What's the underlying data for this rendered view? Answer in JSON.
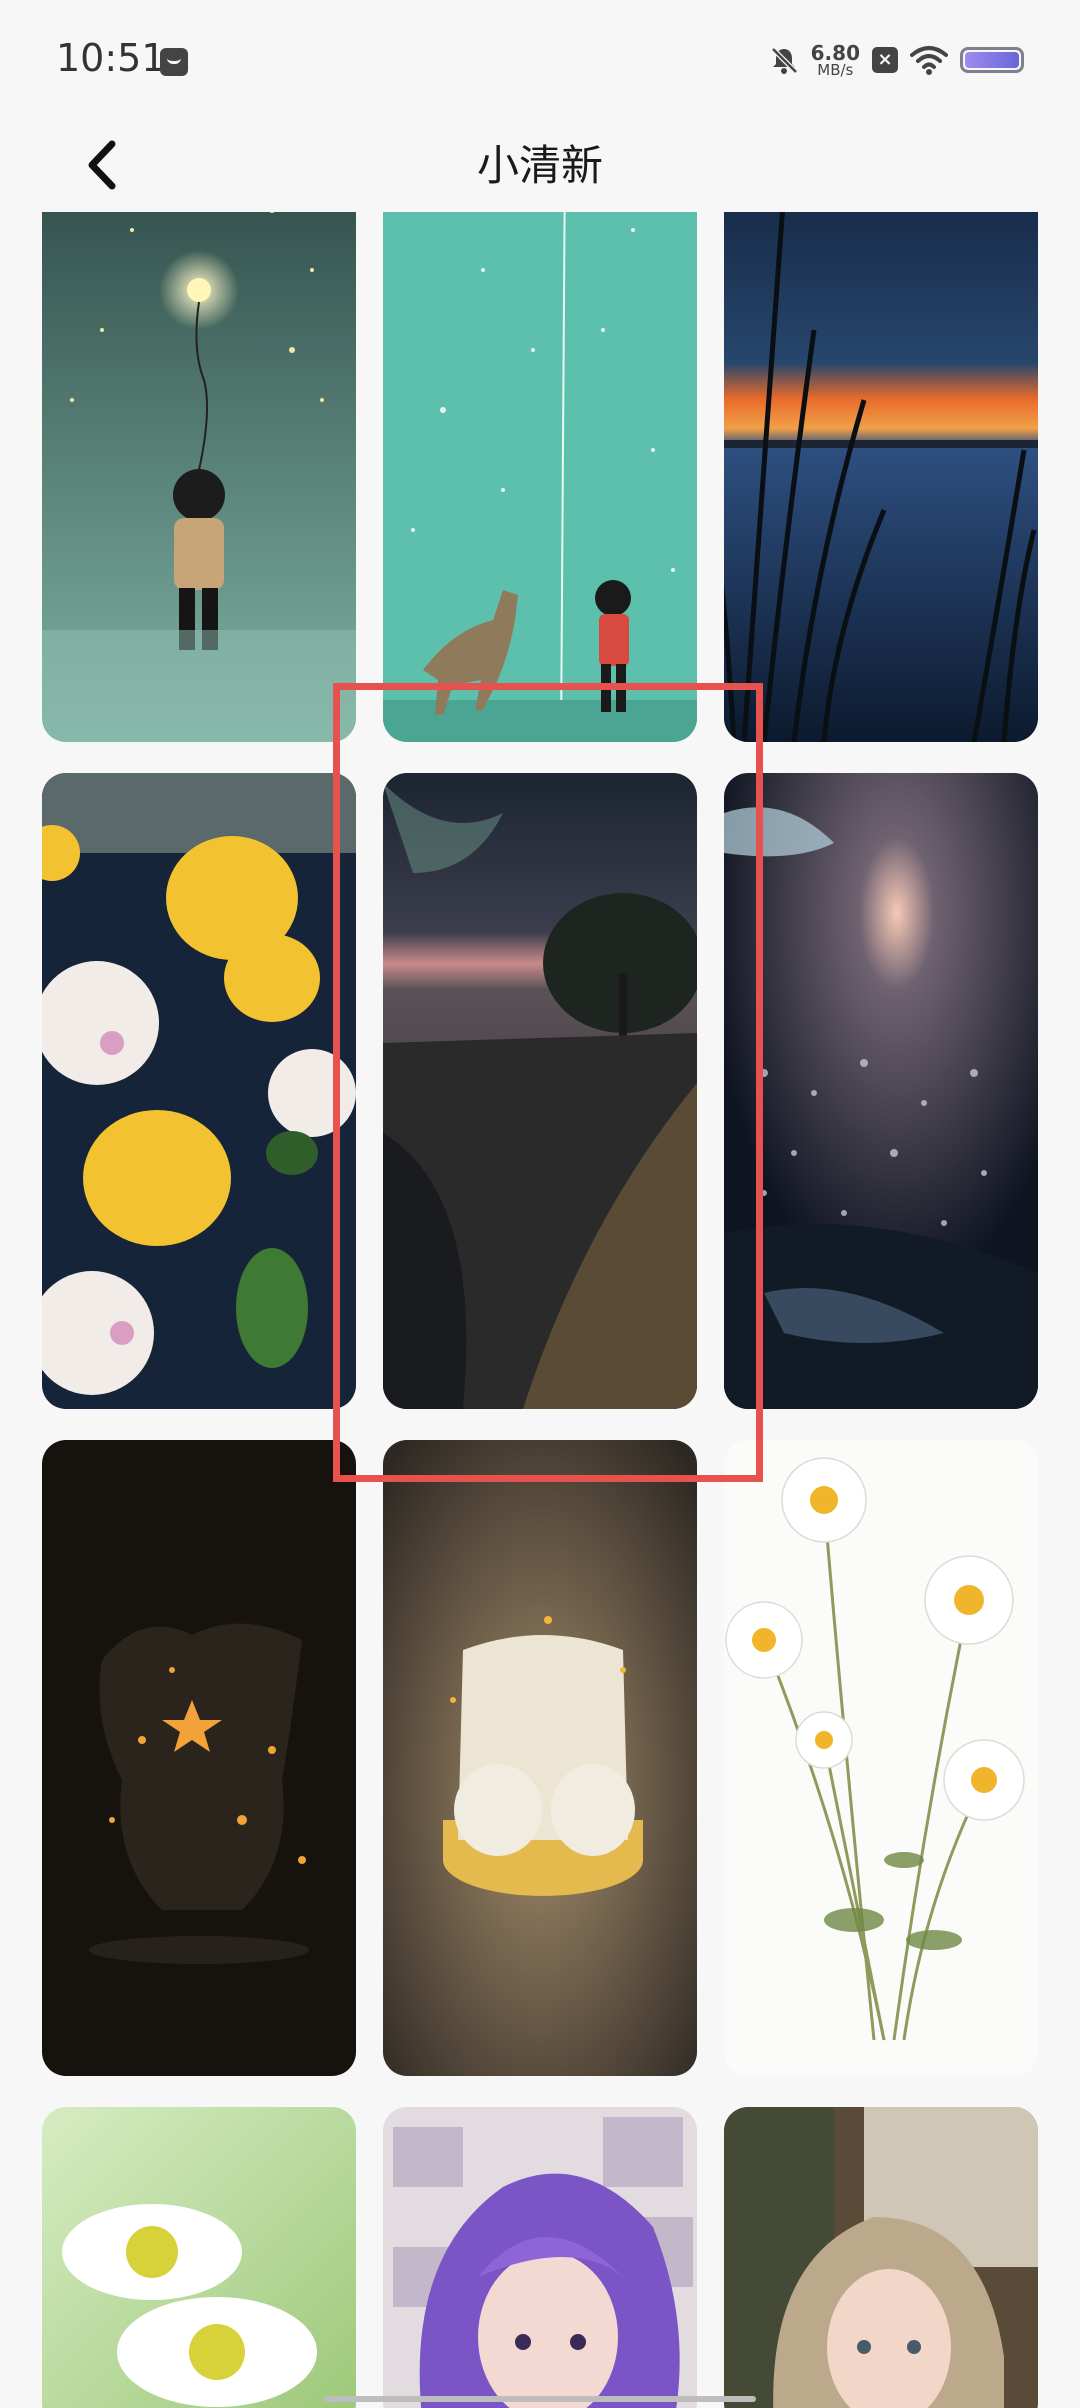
{
  "status_bar": {
    "time": "10:51",
    "net_speed_value": "6.80",
    "net_speed_unit": "MB/s",
    "sim_status": "×"
  },
  "header": {
    "title": "小清新"
  },
  "wallpapers": [
    {
      "name": "wallpaper-boy-balloon-stars"
    },
    {
      "name": "wallpaper-dog-child-stars"
    },
    {
      "name": "wallpaper-moon-lake-reeds"
    },
    {
      "name": "wallpaper-lemons-peonies-water"
    },
    {
      "name": "wallpaper-dark-field-tree"
    },
    {
      "name": "wallpaper-night-flowers-river"
    },
    {
      "name": "wallpaper-star-creature"
    },
    {
      "name": "wallpaper-marshmallow-lamp"
    },
    {
      "name": "wallpaper-daisies"
    },
    {
      "name": "wallpaper-daisy-closeup"
    },
    {
      "name": "wallpaper-purple-hair-girl"
    },
    {
      "name": "wallpaper-blonde-girl-window"
    }
  ],
  "highlight": {
    "target": "wallpaper-dark-field-tree",
    "color": "#e8524e"
  }
}
